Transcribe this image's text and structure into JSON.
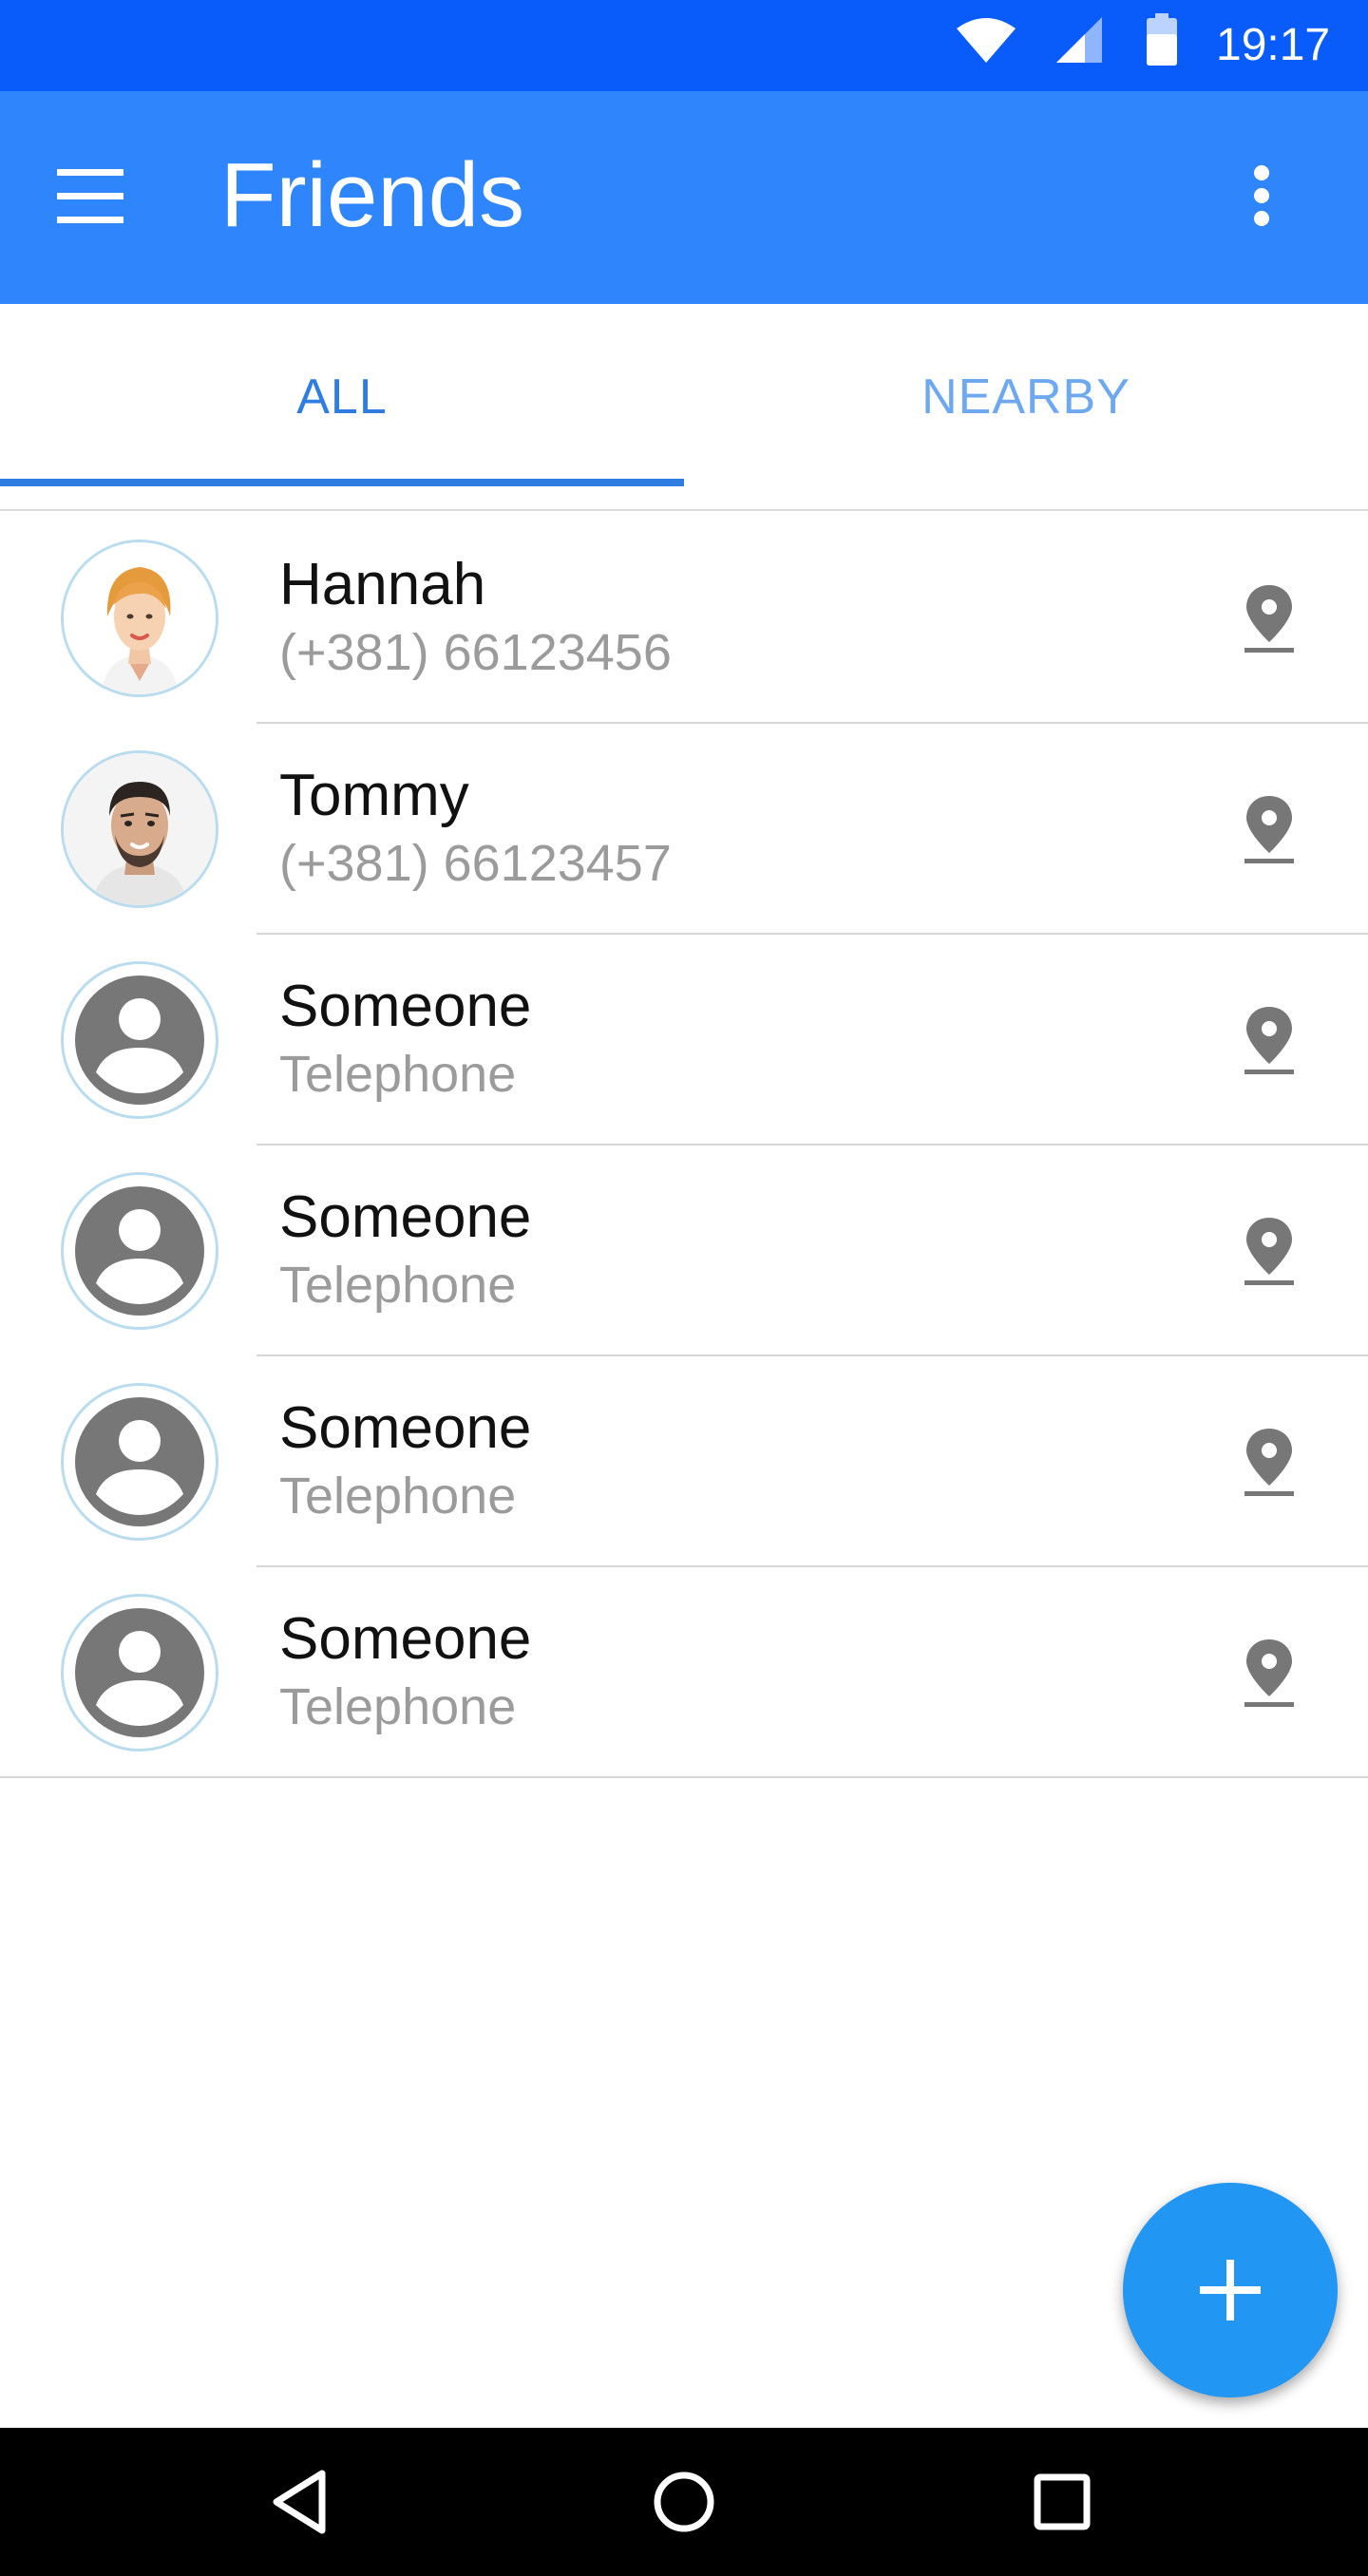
{
  "status_bar": {
    "time": "19:17",
    "icons": [
      "wifi-icon",
      "cell-signal-icon",
      "battery-icon"
    ]
  },
  "app_bar": {
    "title": "Friends",
    "menu_icon": "hamburger-menu-icon",
    "overflow_icon": "more-vert-icon"
  },
  "tabs": [
    {
      "label": "ALL",
      "selected": true
    },
    {
      "label": "NEARBY",
      "selected": false
    }
  ],
  "friends": [
    {
      "name": "Hannah",
      "phone": "(+381) 66123456",
      "avatar": "photo-woman"
    },
    {
      "name": "Tommy",
      "phone": "(+381) 66123457",
      "avatar": "photo-man"
    },
    {
      "name": "Someone",
      "phone": "Telephone",
      "avatar": "placeholder-person"
    },
    {
      "name": "Someone",
      "phone": "Telephone",
      "avatar": "placeholder-person"
    },
    {
      "name": "Someone",
      "phone": "Telephone",
      "avatar": "placeholder-person"
    },
    {
      "name": "Someone",
      "phone": "Telephone",
      "avatar": "placeholder-person"
    }
  ],
  "fab": {
    "icon": "plus-icon"
  },
  "nav_bar": {
    "icons": [
      "back-triangle-icon",
      "home-circle-icon",
      "recents-square-icon"
    ]
  },
  "colors": {
    "status_bar": "#0a5cfa",
    "app_bar": "#2f85fb",
    "tab_selected": "#2f7de1",
    "tab_unselected": "#6ea8f0",
    "fab": "#2196f3",
    "avatar_ring": "#b9dcef",
    "icon_gray": "#7a7a7a"
  }
}
